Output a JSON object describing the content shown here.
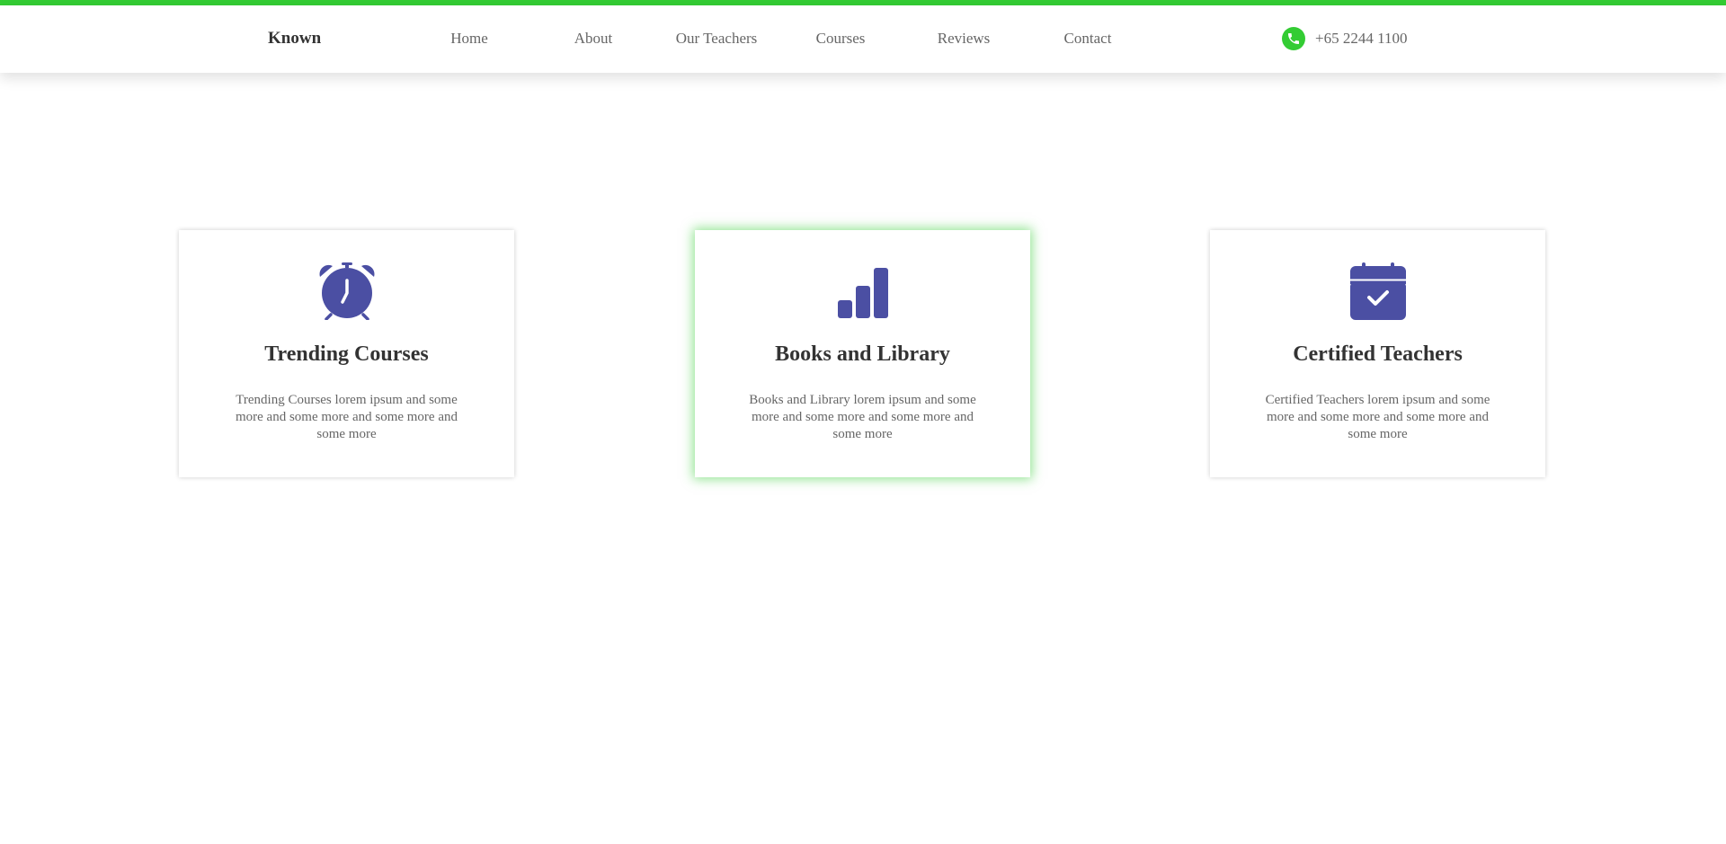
{
  "colors": {
    "accent_green": "#33cc33",
    "icon_purple": "#4b4fa3",
    "heading_text": "#333333",
    "body_text": "#666666"
  },
  "navbar": {
    "brand": "Known",
    "links": [
      {
        "label": "Home"
      },
      {
        "label": "About"
      },
      {
        "label": "Our Teachers"
      },
      {
        "label": "Courses"
      },
      {
        "label": "Reviews"
      },
      {
        "label": "Contact"
      }
    ],
    "phone": {
      "icon": "phone-icon",
      "number": "+65 2244 1100"
    }
  },
  "features": [
    {
      "icon": "alarm-clock-icon",
      "title": "Trending Courses",
      "text": "Trending Courses lorem ipsum and some more and some more and some more and some more"
    },
    {
      "icon": "bar-chart-icon",
      "title": "Books and Library",
      "text": "Books and Library lorem ipsum and some more and some more and some more and some more"
    },
    {
      "icon": "calendar-check-icon",
      "title": "Certified Teachers",
      "text": "Certified Teachers lorem ipsum and some more and some more and some more and some more"
    }
  ]
}
